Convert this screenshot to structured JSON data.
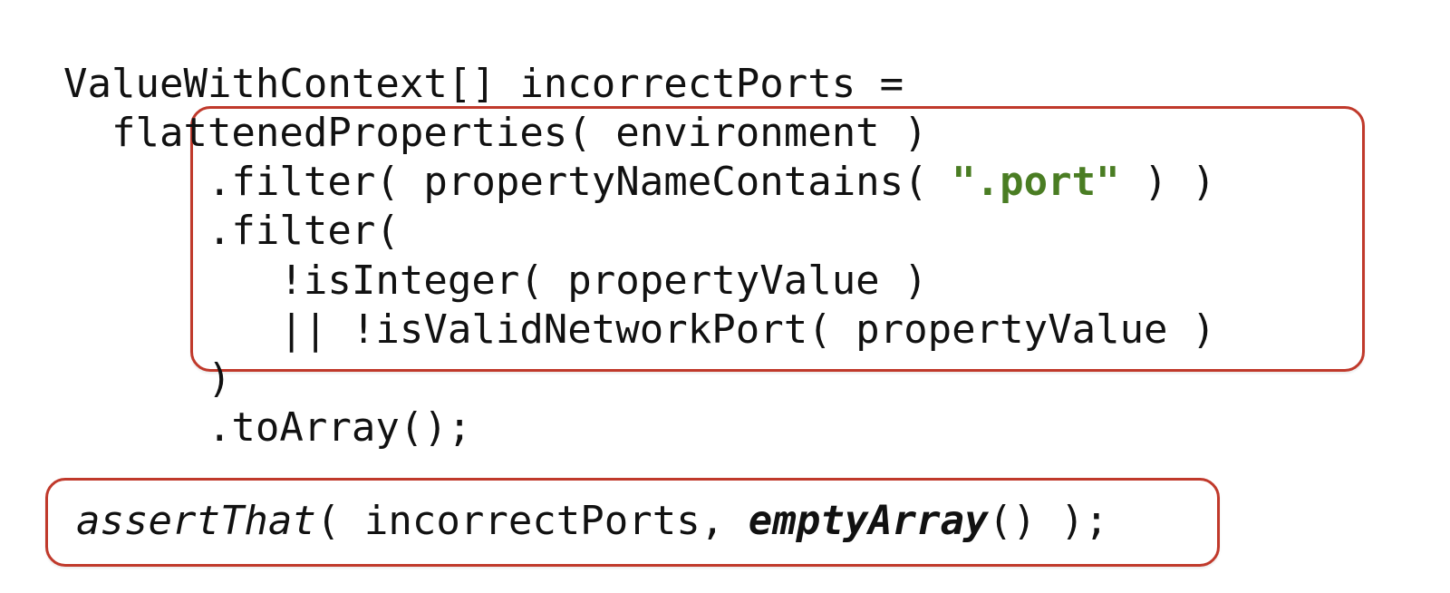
{
  "code": {
    "l1a": "ValueWithContext[] incorrectPorts =",
    "l2a": "  flattenedProperties( environment )",
    "l3_pre": "      .filter( propertyNameContains( ",
    "l3_str": "\".port\"",
    "l3_post": " ) )",
    "l4": "      .filter(",
    "l5": "         !isInteger( propertyValue )",
    "l6": "         || !isValidNetworkPort( propertyValue )",
    "l7": "      )",
    "l8": "      .toArray();"
  },
  "assert": {
    "pre": "assertThat",
    "mid": "( incorrectPorts, ",
    "fn": "emptyArray",
    "post": "() );"
  }
}
